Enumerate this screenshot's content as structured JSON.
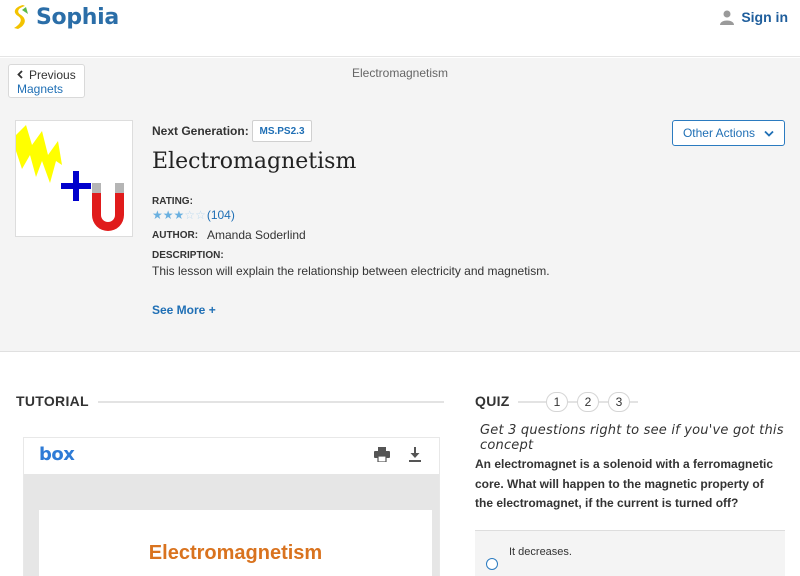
{
  "header": {
    "brand": "Sophia",
    "sign_in": "Sign in"
  },
  "breadcrumb": {
    "previous_label": "Previous",
    "previous_target": "Magnets",
    "current": "Electromagnetism"
  },
  "lesson": {
    "standard_label": "Next Generation:",
    "standard_code": "MS.PS2.3",
    "title": "Electromagnetism",
    "rating_label": "RATING:",
    "rating_stars": 2.5,
    "rating_max": 5,
    "rating_count": "(104)",
    "author_label": "AUTHOR:",
    "author": "Amanda Soderlind",
    "description_label": "DESCRIPTION:",
    "description": "This lesson will explain the relationship between electricity and magnetism.",
    "see_more": "See More +",
    "other_actions": "Other Actions"
  },
  "tutorial": {
    "heading": "TUTORIAL",
    "viewer_brand": "box",
    "document_title": "Electromagnetism"
  },
  "quiz": {
    "heading": "QUIZ",
    "steps": [
      "1",
      "2",
      "3"
    ],
    "tagline": "Get 3 questions right to see if you've got this concept",
    "question": "An electromagnet is a solenoid with a ferromagnetic core. What will happen to the magnetic property of the electromagnet, if the current is turned off?",
    "answers": [
      "It decreases."
    ]
  },
  "colors": {
    "brand_blue": "#2b6ea8",
    "logo_yellow": "#f3c300",
    "link_blue": "#1f6fb5",
    "doc_title_orange": "#d9731f"
  }
}
